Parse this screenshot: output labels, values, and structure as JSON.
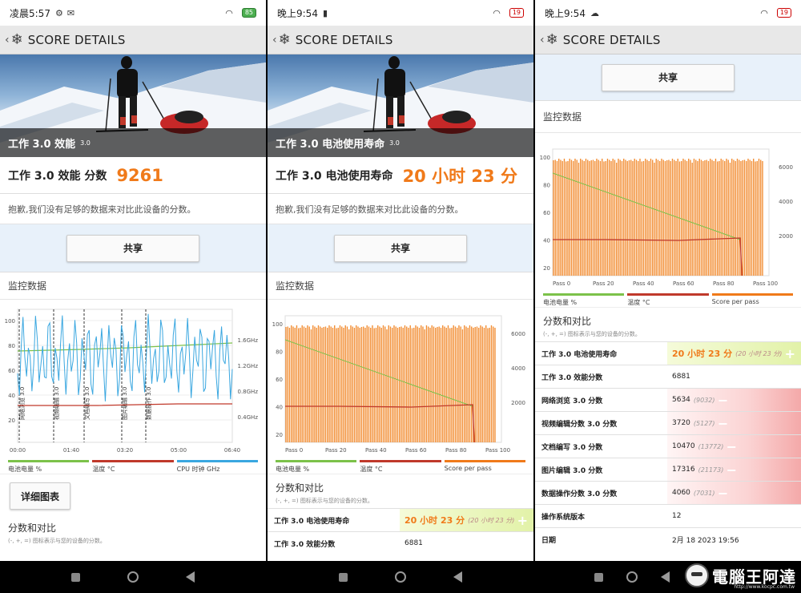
{
  "screens": [
    {
      "status": {
        "time": "凌晨5:57",
        "battery": "85"
      },
      "title": "SCORE DETAILS",
      "hero_label": "工作 3.0 效能",
      "hero_version": "3.0",
      "score_label": "工作 3.0 效能 分数",
      "score_value": "9261",
      "notice": "抱歉,我们没有足够的数据来对比此设备的分数。",
      "share": "共享",
      "monitor": "监控数据",
      "chart_y_left": [
        "100",
        "80",
        "60",
        "40",
        "20"
      ],
      "chart_y_right": [
        "1.6GHz",
        "1.2GHz",
        "0.8GHz",
        "0.4GHz"
      ],
      "chart_x": [
        "00:00",
        "01:40",
        "03:20",
        "05:00",
        "06:40"
      ],
      "chart_events": [
        "网络浏览 3.0",
        "视频编辑 3.0",
        "文档编写 3.0",
        "图片编辑 3.0",
        "数据操作 3.0"
      ],
      "legend": [
        "电池电量 %",
        "温度 °C",
        "CPU 时钟 GHz"
      ],
      "detail_btn": "详细图表",
      "compare_title": "分数和对比",
      "compare_sub": "(-, +, =) 图标表示与您的设备的分数。"
    },
    {
      "status": {
        "time": "晚上9:54",
        "battery": "19"
      },
      "title": "SCORE DETAILS",
      "hero_label": "工作 3.0 电池使用寿命",
      "hero_version": "3.0",
      "score_label": "工作 3.0 电池使用寿命",
      "score_value": "20 小时 23 分",
      "notice": "抱歉,我们没有足够的数据来对比此设备的分数。",
      "share": "共享",
      "monitor": "监控数据",
      "chart_y_left": [
        "100",
        "80",
        "60",
        "40",
        "20"
      ],
      "chart_y_right": [
        "6000",
        "4000",
        "2000"
      ],
      "chart_x": [
        "Pass 0",
        "Pass 20",
        "Pass 40",
        "Pass 60",
        "Pass 80",
        "Pass 100"
      ],
      "legend": [
        "电池电量 %",
        "温度 °C",
        "Score per pass"
      ],
      "compare_title": "分数和对比",
      "compare_sub": "(-, +, =) 图标表示与您的设备的分数。",
      "rows": [
        {
          "k": "工作 3.0 电池使用寿命",
          "v": "20 小时 23 分",
          "p": "(20 小时 23 分)",
          "act": "+"
        },
        {
          "k": "工作 3.0 效能分数",
          "v": "6881",
          "p": "",
          "act": ""
        }
      ]
    },
    {
      "status": {
        "time": "晚上9:54",
        "battery": "19"
      },
      "title": "SCORE DETAILS",
      "share": "共享",
      "monitor": "监控数据",
      "chart_y_left": [
        "100",
        "80",
        "60",
        "40",
        "20"
      ],
      "chart_y_right": [
        "6000",
        "4000",
        "2000"
      ],
      "chart_x": [
        "Pass 0",
        "Pass 20",
        "Pass 40",
        "Pass 60",
        "Pass 80",
        "Pass 100"
      ],
      "legend": [
        "电池电量 %",
        "温度 °C",
        "Score per pass"
      ],
      "compare_title": "分数和对比",
      "compare_sub": "(-, +, =) 图标表示与您的设备的分数。",
      "rows": [
        {
          "k": "工作 3.0 电池使用寿命",
          "v": "20 小时 23 分",
          "p": "(20 小时 23 分)",
          "act": "+"
        },
        {
          "k": "工作 3.0 效能分数",
          "v": "6881",
          "p": "",
          "act": ""
        },
        {
          "k": "网络浏览 3.0 分数",
          "v": "5634",
          "p": "(9032)",
          "act": "−"
        },
        {
          "k": "视频编辑分数 3.0 分数",
          "v": "3720",
          "p": "(5127)",
          "act": "−"
        },
        {
          "k": "文档编写 3.0 分数",
          "v": "10470",
          "p": "(13772)",
          "act": "−"
        },
        {
          "k": "图片编辑 3.0 分数",
          "v": "17316",
          "p": "(21173)",
          "act": "−"
        },
        {
          "k": "数据操作分数 3.0 分数",
          "v": "4060",
          "p": "(7031)",
          "act": "−"
        },
        {
          "k": "操作系统版本",
          "v": "12",
          "p": "",
          "act": ""
        },
        {
          "k": "日期",
          "v": "2月 18 2023 19:56",
          "p": "",
          "act": ""
        }
      ]
    }
  ],
  "watermark": {
    "text": "電腦王阿達",
    "url": "http://www.kocpc.com.tw"
  },
  "colors": {
    "orange": "#f07a1a",
    "green": "#7cc24a",
    "red": "#c0392b",
    "blue": "#3aa7e0"
  }
}
